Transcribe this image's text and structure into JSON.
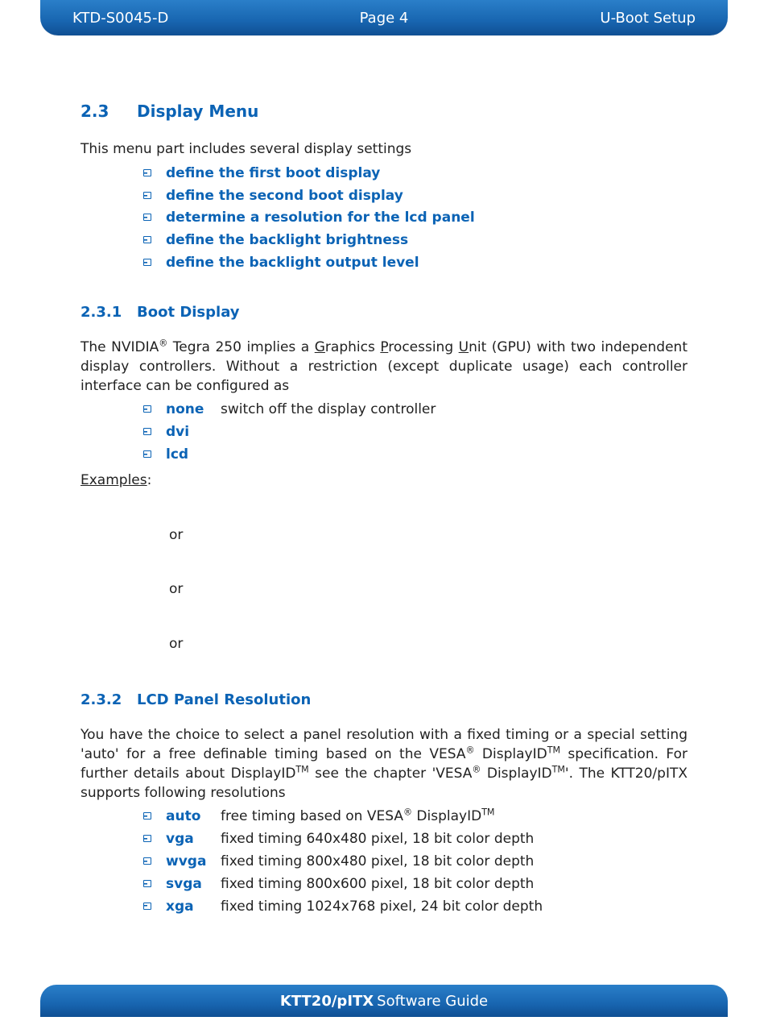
{
  "header": {
    "left": "KTD-S0045-D",
    "center": "Page 4",
    "right": "U-Boot Setup"
  },
  "section": {
    "num": "2.3",
    "title": "Display Menu",
    "intro": "This menu part includes several display settings",
    "bullets": [
      "define the first boot display",
      "define the second boot display",
      "determine a resolution for the lcd panel",
      "define the backlight brightness",
      "define the backlight output level"
    ]
  },
  "sub1": {
    "num": "2.3.1",
    "title": "Boot Display",
    "para_pre": "The NVIDIA",
    "para_mid1": " Tegra 250 implies a ",
    "gpu_g": "G",
    "gpu_p": "P",
    "gpu_u": "U",
    "para_mid2": "raphics ",
    "para_mid3": "rocessing ",
    "para_mid4": "nit (GPU) with two independent display controllers. Without a restriction (except duplicate usage) each controller interface can be configured as",
    "opts": [
      {
        "term": "none",
        "desc": "switch off the display controller"
      },
      {
        "term": "dvi",
        "desc": ""
      },
      {
        "term": "lcd",
        "desc": ""
      }
    ],
    "examples_label": "Examples",
    "ors": [
      "or",
      "or",
      "or"
    ]
  },
  "sub2": {
    "num": "2.3.2",
    "title": "LCD Panel Resolution",
    "para_a": "You have the choice to select a panel resolution with a fixed timing or a special setting 'auto' for a free definable timing based on the VESA",
    "para_b": " DisplayID",
    "para_c": " specification. For further details about DisplayID",
    "para_d": " see the chapter 'VESA",
    "para_e": " DisplayID",
    "para_f": "'. The KTT20/pITX supports following resolutions",
    "opts": [
      {
        "term": "auto",
        "desc_a": "free timing based on VESA",
        "desc_b": " DisplayID"
      },
      {
        "term": "vga",
        "desc": "fixed timing 640x480 pixel, 18 bit color depth"
      },
      {
        "term": "wvga",
        "desc": "fixed timing 800x480 pixel, 18 bit color depth"
      },
      {
        "term": "svga",
        "desc": "fixed timing 800x600 pixel, 18 bit color depth"
      },
      {
        "term": "xga",
        "desc": "fixed timing 1024x768 pixel, 24 bit color depth"
      }
    ]
  },
  "footer": {
    "bold": "KTT20/pITX",
    "rest": " Software Guide"
  },
  "symbols": {
    "reg": "®",
    "tm": "TM",
    "colon": ":"
  }
}
